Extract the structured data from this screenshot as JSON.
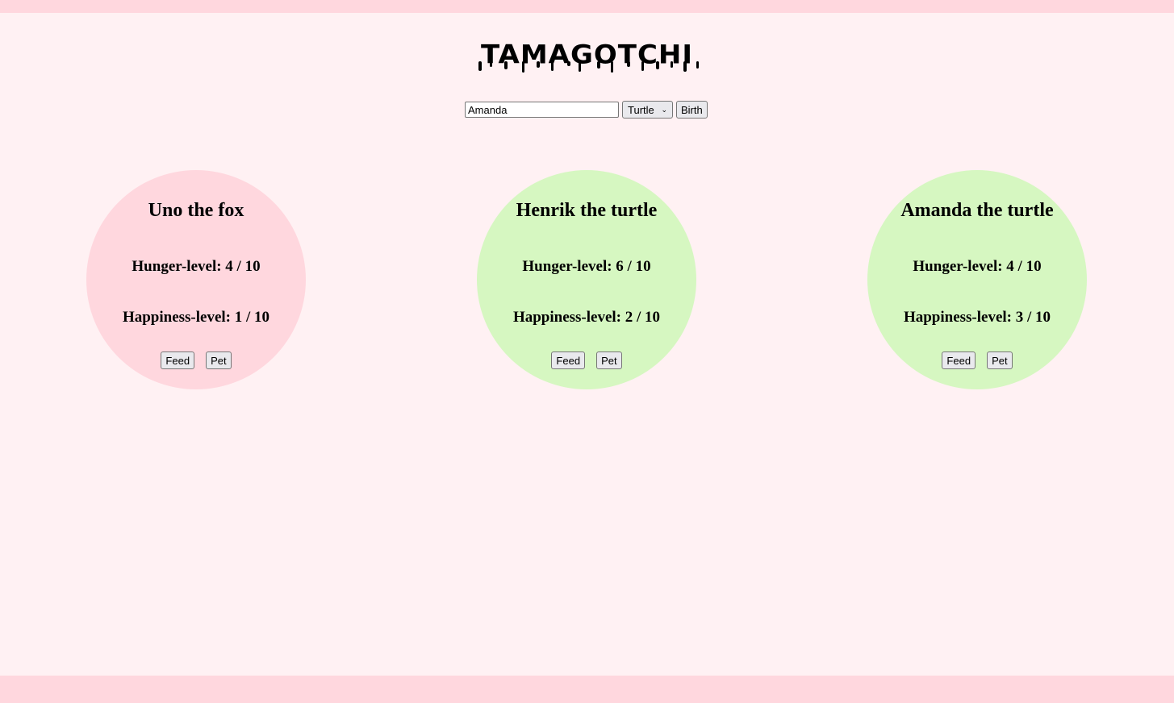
{
  "header": {
    "title": "TAMAGOTCHI"
  },
  "form": {
    "name_value": "Amanda",
    "species_selected": "Turtle",
    "birth_label": "Birth"
  },
  "colors": {
    "fox": "#ffd7de",
    "turtle": "#d6f7c1",
    "background": "#fff1f3"
  },
  "pets": [
    {
      "name": "Uno the fox",
      "hunger": "Hunger-level: 4 / 10",
      "happiness": "Happiness-level: 1 / 10",
      "feed_label": "Feed",
      "pet_label": "Pet"
    },
    {
      "name": "Henrik the turtle",
      "hunger": "Hunger-level: 6 / 10",
      "happiness": "Happiness-level: 2 / 10",
      "feed_label": "Feed",
      "pet_label": "Pet"
    },
    {
      "name": "Amanda the turtle",
      "hunger": "Hunger-level: 4 / 10",
      "happiness": "Happiness-level: 3 / 10",
      "feed_label": "Feed",
      "pet_label": "Pet"
    }
  ]
}
